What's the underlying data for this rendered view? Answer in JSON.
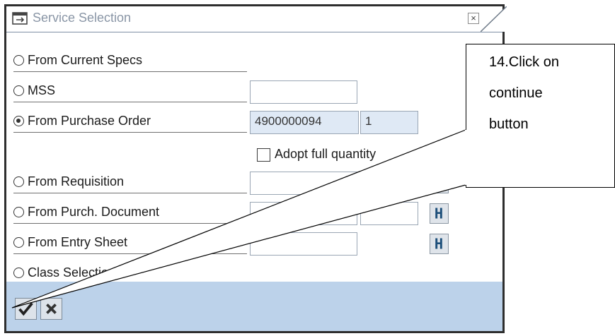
{
  "dialog": {
    "title": "Service Selection",
    "close_icon": "close-icon",
    "options": [
      {
        "label": "From Current Specs",
        "checked": false
      },
      {
        "label": "MSS",
        "checked": false
      },
      {
        "label": "From Purchase Order",
        "checked": true
      },
      {
        "label": "From Requisition",
        "checked": false
      },
      {
        "label": "From Purch. Document",
        "checked": false
      },
      {
        "label": "From Entry Sheet",
        "checked": false
      },
      {
        "label": "Class Selection",
        "checked": false
      }
    ],
    "purchase_order": {
      "number": "4900000094",
      "item": "1"
    },
    "adopt_full_quantity": {
      "label": "Adopt full quantity",
      "checked": false
    },
    "toolbar": {
      "continue_icon": "checkmark-icon",
      "cancel_icon": "cancel-x-icon"
    },
    "selection_icon": "multiple-selection-icon"
  },
  "callout": {
    "lines": [
      "14.Click on",
      "continue",
      "button"
    ]
  },
  "colors": {
    "bottom_bar": "#bcd2ea",
    "readonly_field": "#dfe9f5",
    "frame": "#2e2e2e"
  }
}
